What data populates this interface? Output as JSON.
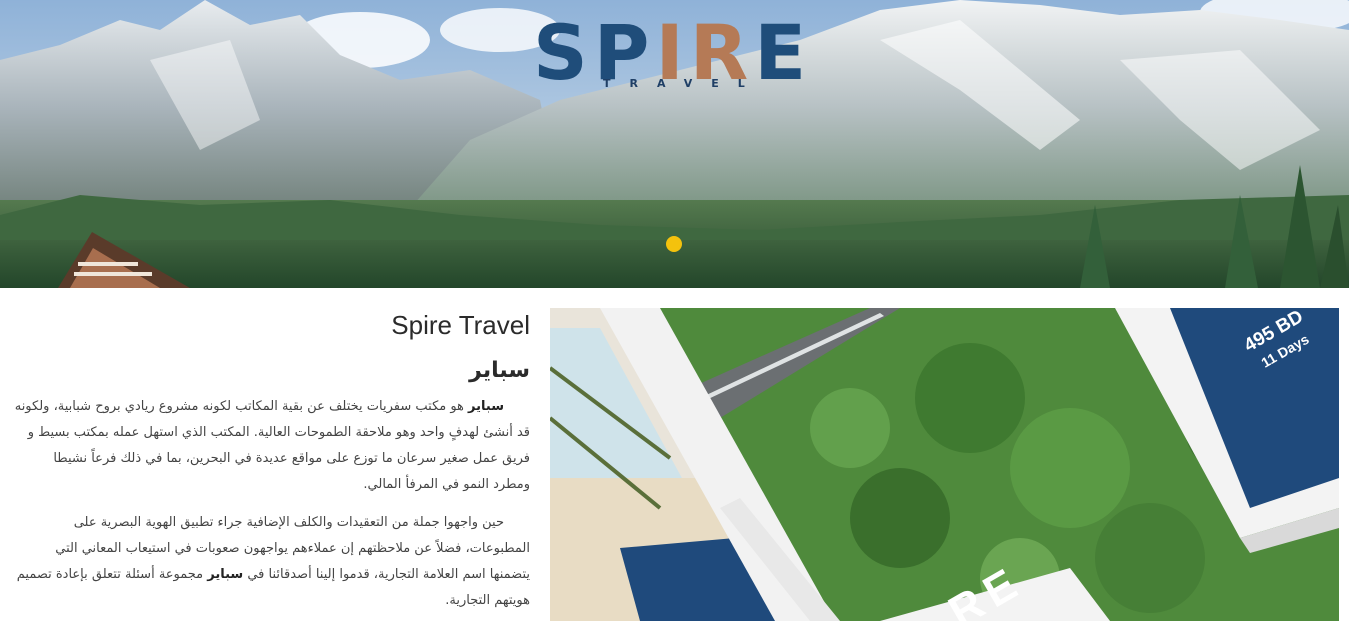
{
  "hero": {
    "logo": {
      "main": "SPIRE",
      "sub": "TRAVEL"
    },
    "slider_dot_color": "#f4c20d"
  },
  "content": {
    "title": "Spire Travel",
    "heading": "سباير",
    "p1_bold": "سباير",
    "p1_text": " هو مكتب سفريات يختلف عن بقية المكاتب لكونه مشروع ريادي بروح شبابية، ولكونه قد أنشئ لهدفٍ واحد وهو ملاحقة الطموحات العالية. المكتب الذي استهل عمله بمكتب بسيط و فريق عمل صغير سرعان ما توزع على مواقع عديدة في البحرين، بما في ذلك فرعاً نشيطا ومطرد النمو في المرفأ المالي.",
    "p2_text_a": "حين واجهوا جملة من التعقيدات والكلف الإضافية جراء تطبيق الهوية البصرية على المطبوعات، فضلاً عن ملاحظتهم إن عملاءهم يواجهون صعوبات في استيعاب المعاني التي يتضمنها اسم العلامة التجارية، قدموا إلينا أصدقائنا في ",
    "p2_bold": "سباير",
    "p2_text_b": " مجموعة أسئلة تتعلق بإعادة تصميم هويتهم التجارية."
  },
  "feature": {
    "price": "495 BD",
    "days": "11 Days",
    "card_brand": "RE",
    "colors": {
      "navy": "#1f4a7c",
      "brand_brown": "#b57a56"
    }
  }
}
